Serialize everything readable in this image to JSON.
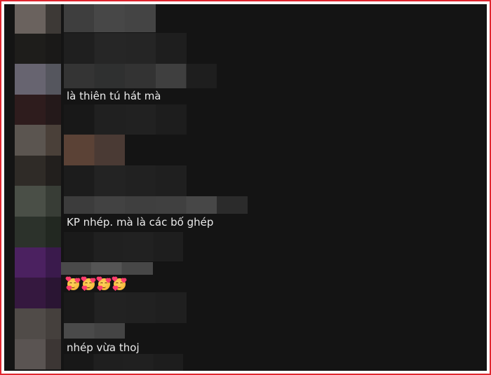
{
  "comments": [
    {
      "text": "là thiên tú hát mà"
    },
    {
      "text": "KP nhép. mà là các bố ghép"
    },
    {
      "emoji": [
        "smiling-face-with-hearts",
        "smiling-face-with-hearts",
        "smiling-face-with-hearts",
        "smiling-face-with-hearts"
      ]
    },
    {
      "text": "nhép vừa thoj"
    }
  ],
  "colors": {
    "background": "#141414",
    "text": "#eaeaea",
    "frame_border": "#e0262f"
  }
}
